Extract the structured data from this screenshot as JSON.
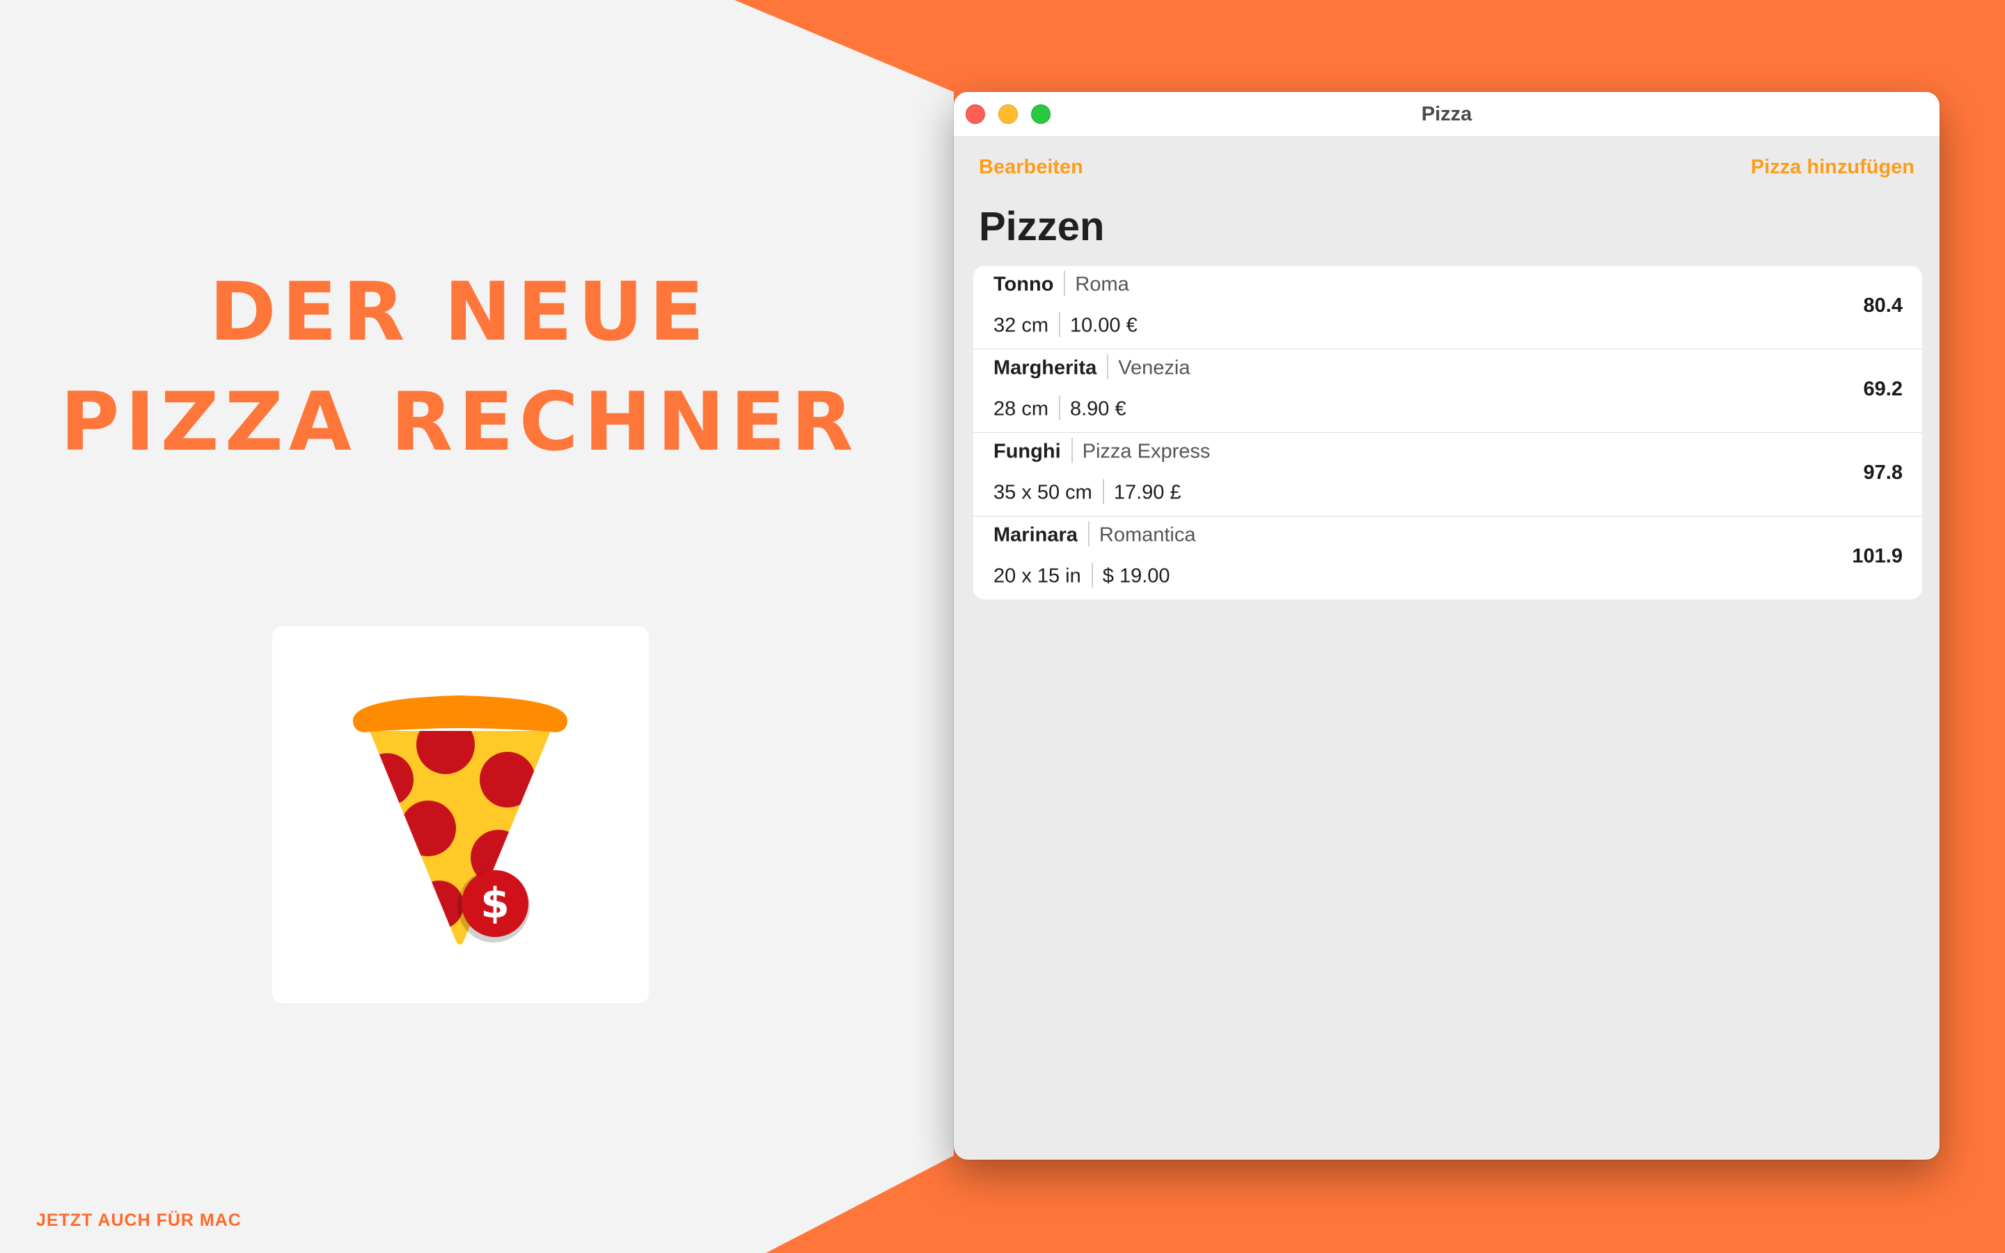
{
  "colors": {
    "brand_orange": "#ff763a",
    "link_orange": "#ff9c18",
    "background_light": "#f3f3f3"
  },
  "promo": {
    "headline_line1": "DER NEUE",
    "headline_line2": "PIZZA RECHNER",
    "footer_note": "JETZT AUCH FÜR MAC",
    "app_icon": "pizza-slice-dollar-icon"
  },
  "window": {
    "title": "Pizza",
    "toolbar": {
      "edit_label": "Bearbeiten",
      "add_label": "Pizza hinzufügen"
    },
    "page_title": "Pizzen",
    "pizzas": [
      {
        "name": "Tonno",
        "place": "Roma",
        "size": "32 cm",
        "price": "10.00 €",
        "score": "80.4"
      },
      {
        "name": "Margherita",
        "place": "Venezia",
        "size": "28 cm",
        "price": "8.90 €",
        "score": "69.2"
      },
      {
        "name": "Funghi",
        "place": "Pizza Express",
        "size": "35 x 50 cm",
        "price": "17.90 £",
        "score": "97.8"
      },
      {
        "name": "Marinara",
        "place": "Romantica",
        "size": "20 x 15 in",
        "price": "$ 19.00",
        "score": "101.9"
      }
    ]
  }
}
